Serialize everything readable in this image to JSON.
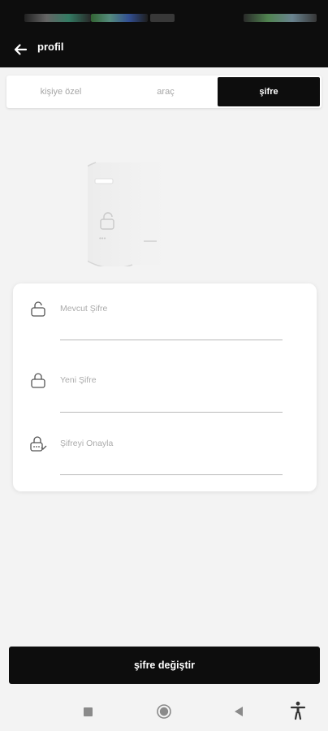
{
  "app_bar": {
    "title": "profil",
    "back_icon": "arrow-left-icon"
  },
  "tabs": [
    {
      "label": "kişiye özel",
      "selected": false
    },
    {
      "label": "araç",
      "selected": false
    },
    {
      "label": "şifre",
      "selected": true
    }
  ],
  "illustration": {
    "icon": "lock-illustration-icon"
  },
  "form": {
    "fields": [
      {
        "label": "Mevcut Şifre",
        "value": "",
        "icon": "unlocked-lock-icon"
      },
      {
        "label": "Yeni Şifre",
        "value": "",
        "icon": "lock-icon"
      },
      {
        "label": "Şifreyi Onayla",
        "value": "",
        "icon": "lock-check-icon"
      }
    ]
  },
  "submit": {
    "label": "şifre değiştir"
  },
  "navigation": {
    "recents_icon": "square-icon",
    "home_icon": "circle-home-icon",
    "back_icon": "triangle-back-icon",
    "accessibility_icon": "accessibility-icon"
  },
  "colors": {
    "primary": "#0d0d0d",
    "background": "#f3f3f3",
    "surface": "#ffffff",
    "muted_text": "#ababab"
  }
}
